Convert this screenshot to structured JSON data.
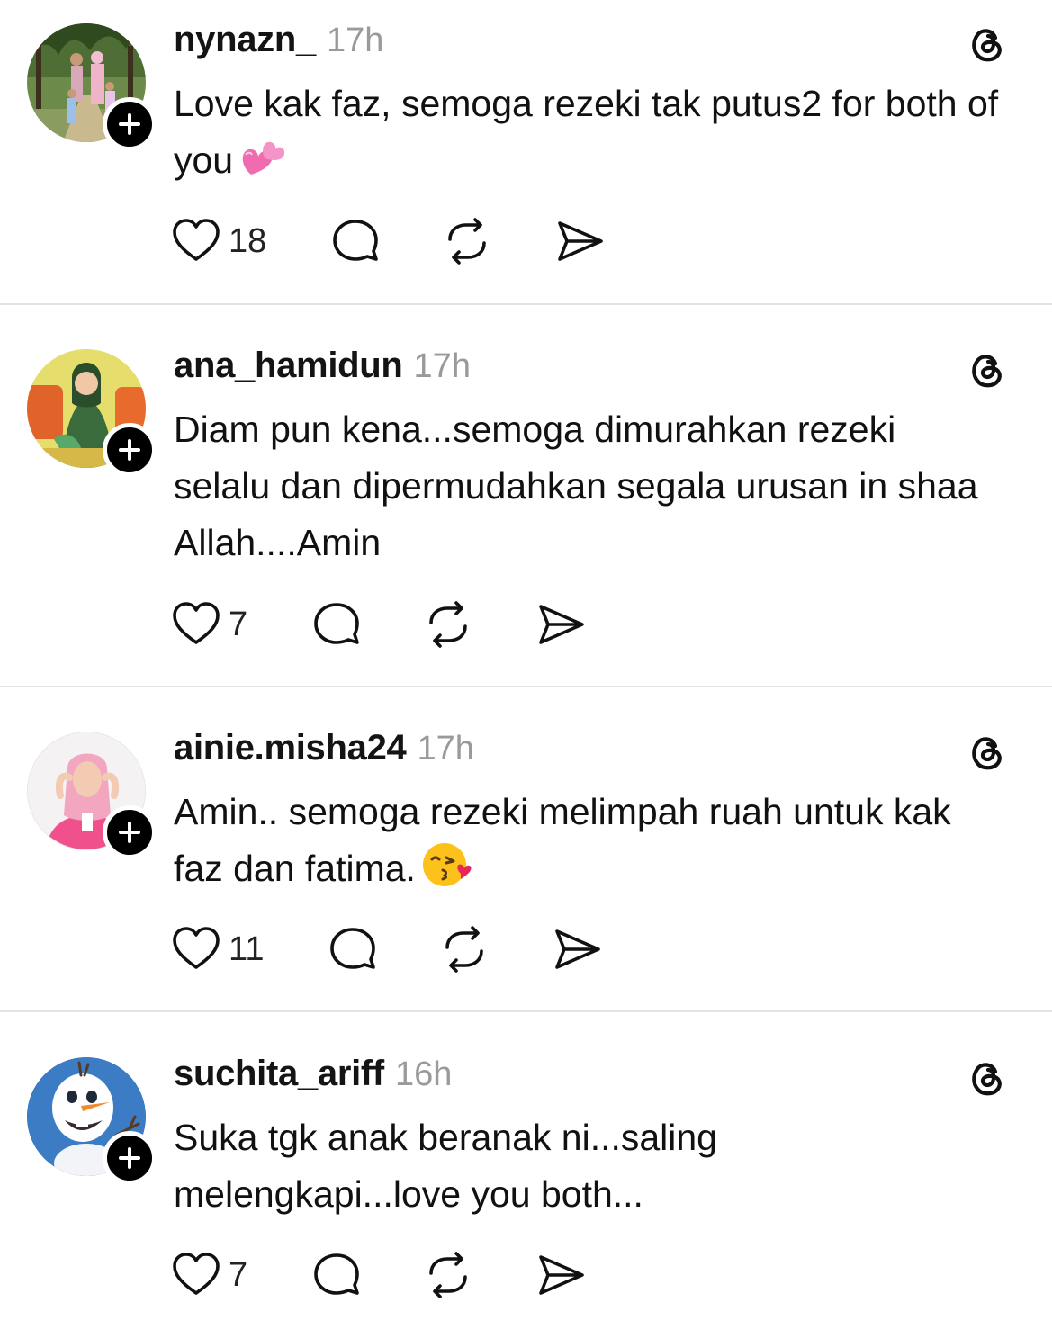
{
  "colors": {
    "text": "#111111",
    "muted": "#9a9a9a",
    "divider": "#e3e3e3",
    "badge": "#000000"
  },
  "posts": [
    {
      "username": "nynazn_",
      "time": "17h",
      "text": "Love kak faz, semoga rezeki tak putus2 for both of you",
      "emoji": "revolving-hearts",
      "likes": "18",
      "avatar": "family-outdoor-photo"
    },
    {
      "username": "ana_hamidun",
      "time": "17h",
      "text": "Diam pun kena...semoga dimurahkan rezeki selalu dan dipermudahkan segala urusan in shaa Allah....Amin",
      "emoji": "",
      "likes": "7",
      "avatar": "woman-green-dress-illustration"
    },
    {
      "username": "ainie.misha24",
      "time": "17h",
      "text": "Amin.. semoga rezeki melimpah ruah untuk kak faz dan fatima.",
      "emoji": "face-blowing-kiss",
      "likes": "11",
      "avatar": "woman-pink-hijab"
    },
    {
      "username": "suchita_ariff",
      "time": "16h",
      "text": "Suka tgk anak beranak ni...saling melengkapi...love you both...",
      "emoji": "",
      "likes": "7",
      "avatar": "olaf-snowman"
    }
  ]
}
